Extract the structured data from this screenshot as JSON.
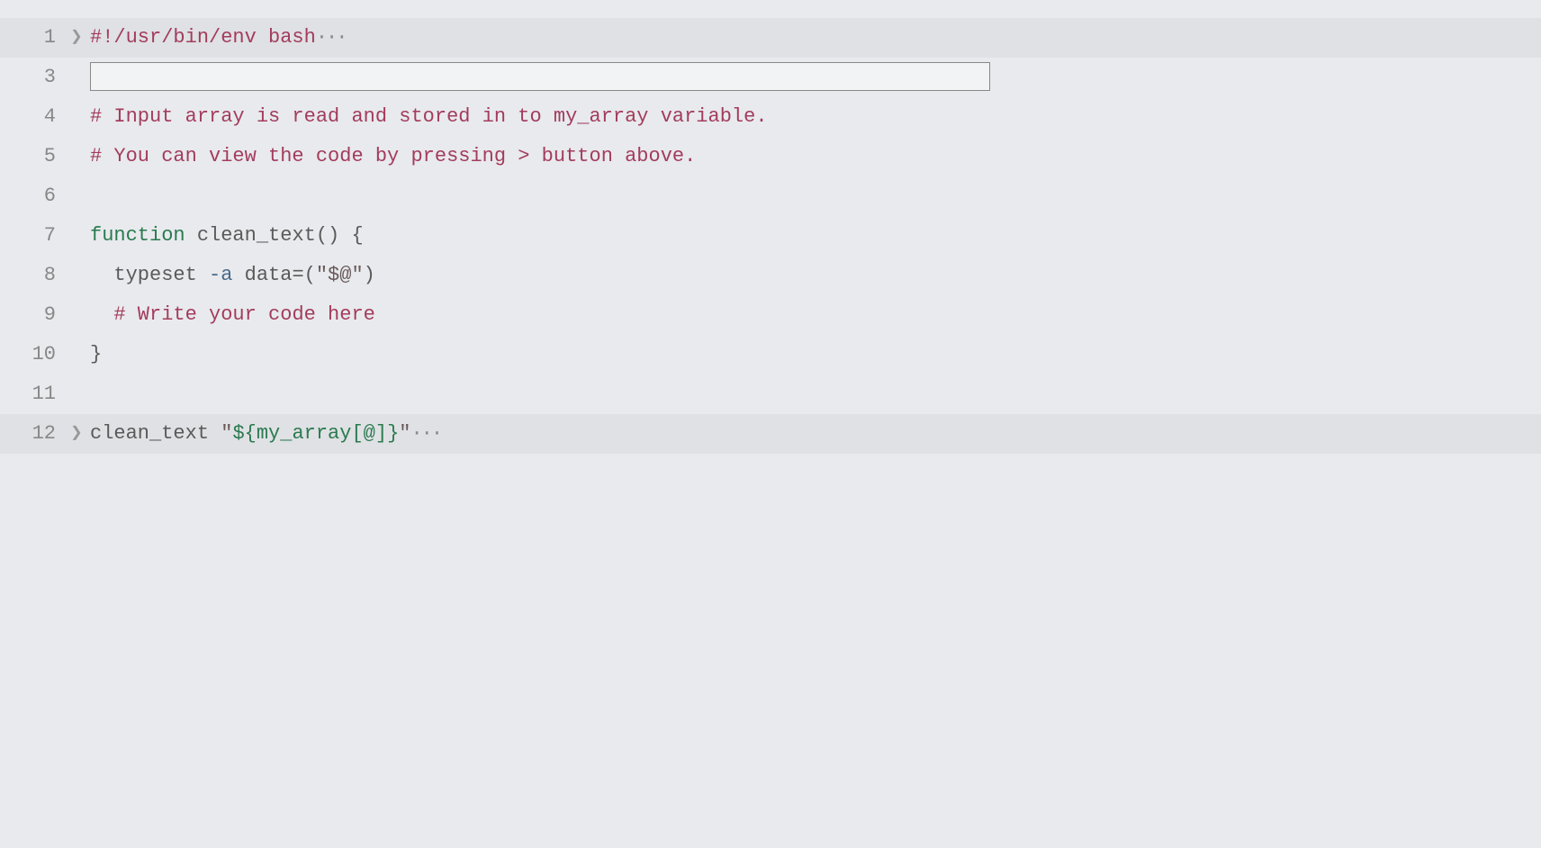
{
  "editor": {
    "lines": [
      {
        "num": "1",
        "fold": "❯",
        "hl": true
      },
      {
        "num": "3",
        "fold": "",
        "hl": false
      },
      {
        "num": "4",
        "fold": "",
        "hl": false
      },
      {
        "num": "5",
        "fold": "",
        "hl": false
      },
      {
        "num": "6",
        "fold": "",
        "hl": false
      },
      {
        "num": "7",
        "fold": "",
        "hl": false
      },
      {
        "num": "8",
        "fold": "",
        "hl": false
      },
      {
        "num": "9",
        "fold": "",
        "hl": false
      },
      {
        "num": "10",
        "fold": "",
        "hl": false
      },
      {
        "num": "11",
        "fold": "",
        "hl": false
      },
      {
        "num": "12",
        "fold": "❯",
        "hl": true
      }
    ],
    "tokens": {
      "l1_shebang": "#!/usr/bin/env bash",
      "l1_dots": "···",
      "l4_comment": "# Input array is read and stored in to my_array variable.",
      "l5_comment": "# You can view the code by pressing > button above.",
      "l7_keyword": "function",
      "l7_fname": " clean_text",
      "l7_rest": "() {",
      "l8_indent": "  ",
      "l8_cmd": "typeset ",
      "l8_flag": "-a",
      "l8_rest1": " data=(",
      "l8_str": "\"$@\"",
      "l8_rest2": ")",
      "l9_indent": "  ",
      "l9_comment": "# Write your code here",
      "l10_brace": "}",
      "l12_call": "clean_text ",
      "l12_q1": "\"",
      "l12_var": "${my_array[@]}",
      "l12_q2": "\"",
      "l12_dots": "···"
    }
  }
}
